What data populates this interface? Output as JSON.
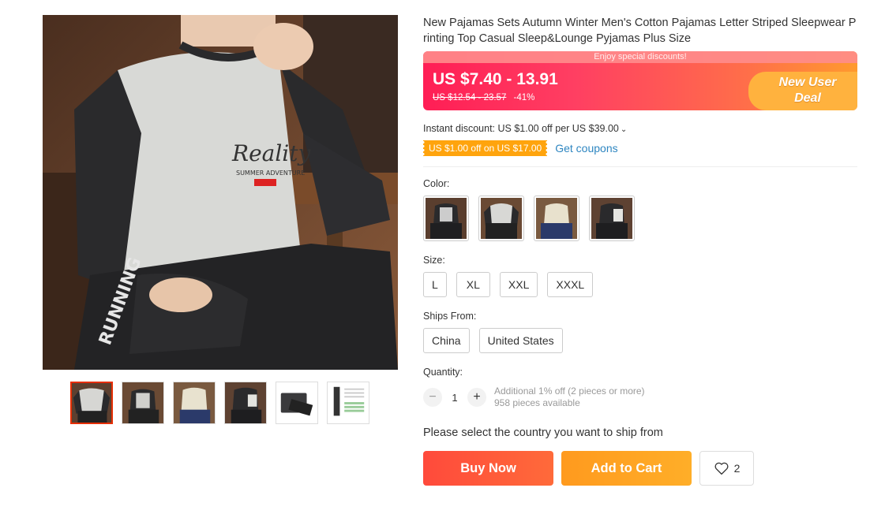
{
  "product": {
    "title": "New Pajamas Sets Autumn Winter Men's Cotton Pajamas Letter Striped Sleepwear Printing Top Casual Sleep&Lounge Pyjamas Plus Size"
  },
  "price": {
    "promo_strip": "Enjoy special discounts!",
    "current": "US $7.40 - 13.91",
    "original": "US $12.54 - 23.57",
    "discount": "-41%",
    "badge_line1": "New User",
    "badge_line2": "Deal"
  },
  "discounts": {
    "instant": "Instant discount: US $1.00 off per US $39.00",
    "coupon_tag": "US $1.00 off on US $17.00",
    "get_coupons": "Get coupons"
  },
  "color": {
    "label": "Color:"
  },
  "size": {
    "label": "Size:",
    "options": [
      "L",
      "XL",
      "XXL",
      "XXXL"
    ]
  },
  "ships_from": {
    "label": "Ships From:",
    "options": [
      "China",
      "United States"
    ]
  },
  "quantity": {
    "label": "Quantity:",
    "value": "1",
    "note_line1": "Additional 1% off (2 pieces or more)",
    "note_line2": "958 pieces available"
  },
  "ship_message": "Please select the country you want to ship from",
  "actions": {
    "buy_now": "Buy Now",
    "add_to_cart": "Add to Cart",
    "wishlist_count": "2"
  },
  "colors": {
    "accent_red": "#ff4a3b",
    "accent_orange": "#ffa40d",
    "link_blue": "#2e86c1"
  }
}
